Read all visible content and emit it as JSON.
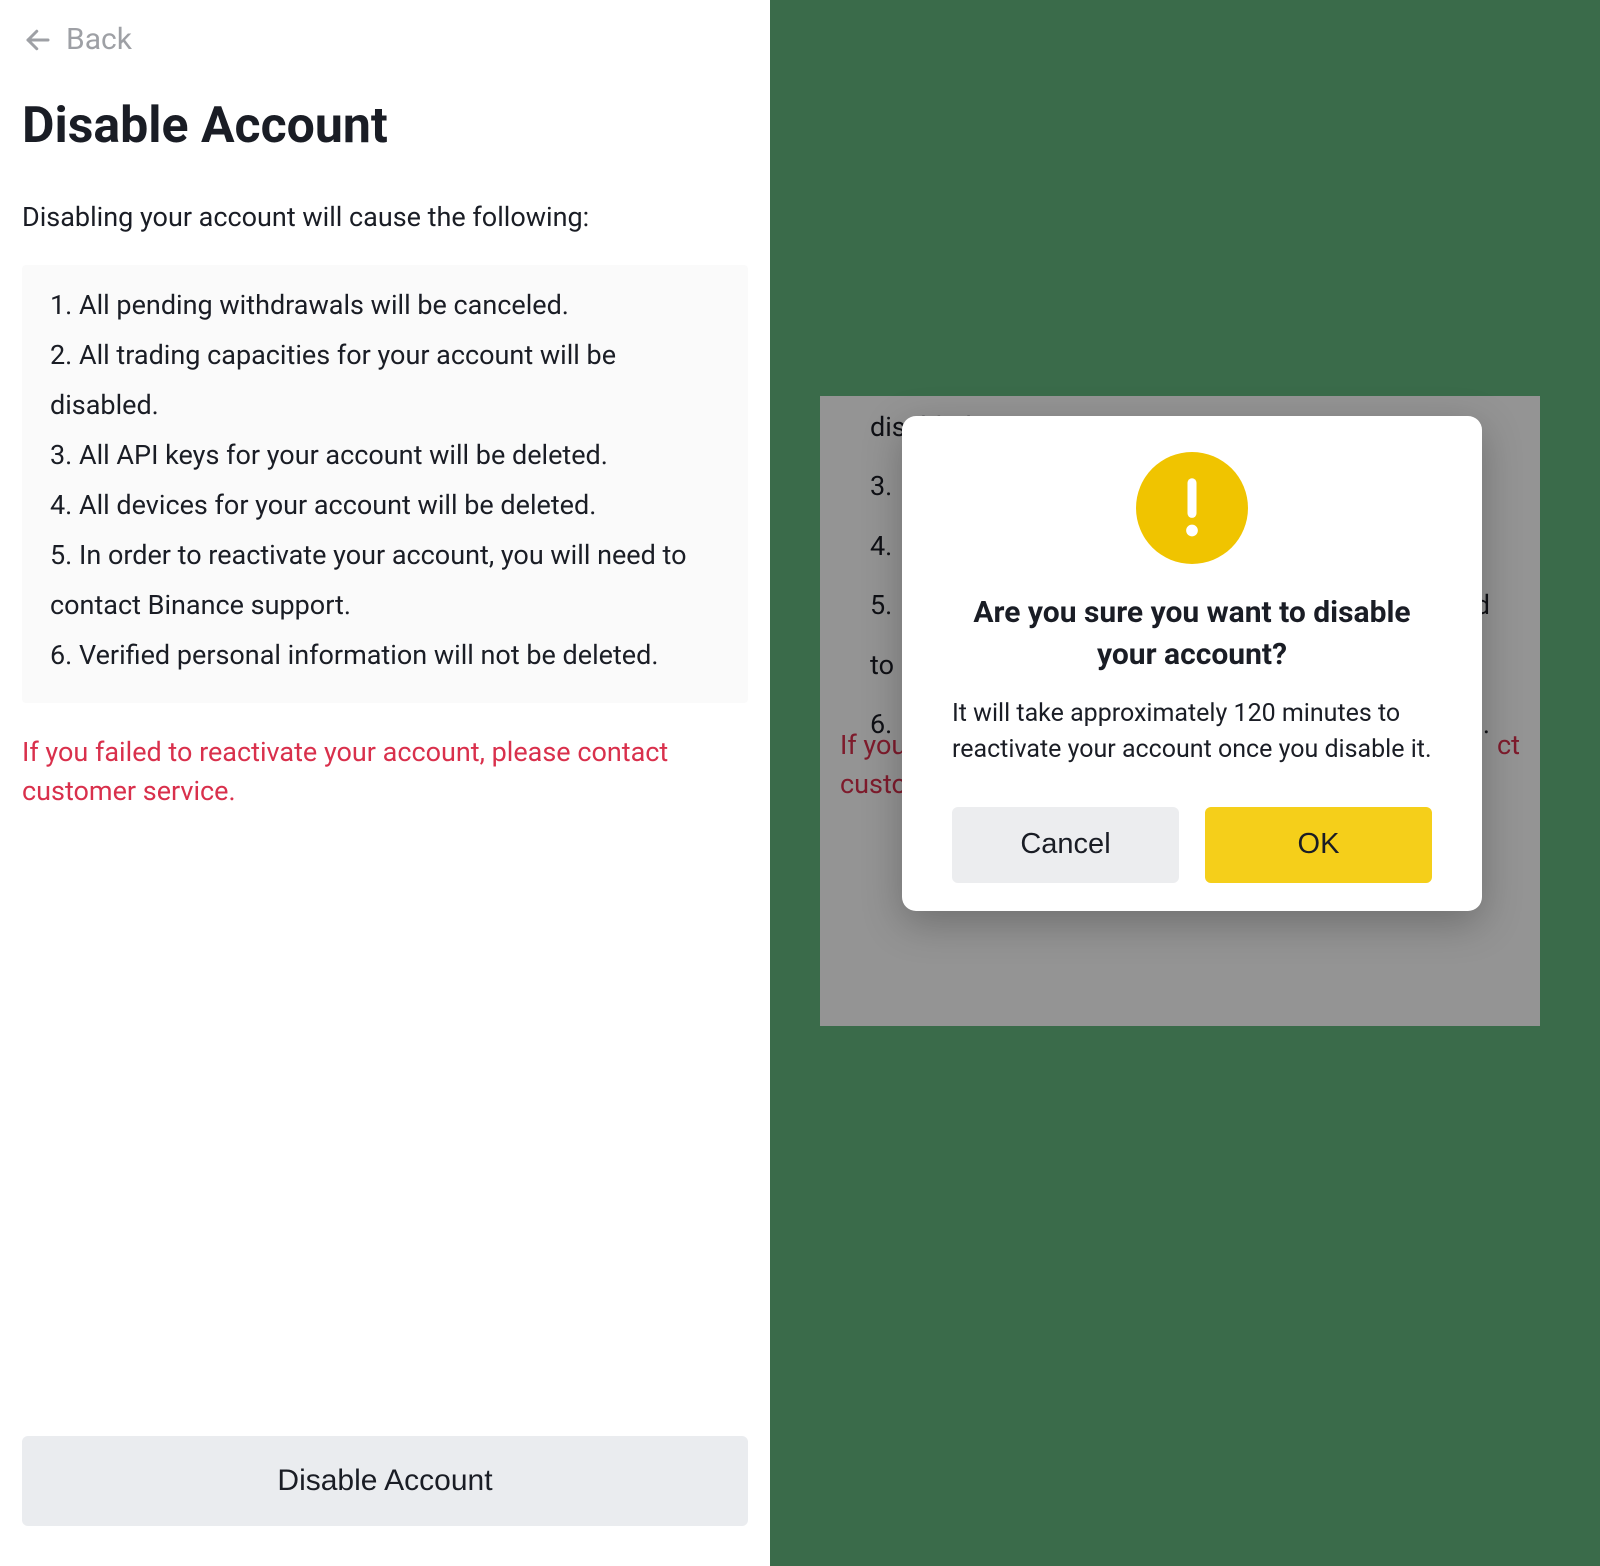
{
  "left": {
    "back_label": "Back",
    "title": "Disable Account",
    "subhead": "Disabling your account will cause the following:",
    "consequences": [
      "1. All pending withdrawals will be canceled.",
      "2. All trading capacities for your account will be disabled.",
      "3. All API keys for your account will be deleted.",
      "4. All devices for your account will be deleted.",
      "5. In order to reactivate your account, you will need to contact Binance support.",
      "6. Verified personal information will not be deleted."
    ],
    "warning": "If you failed to reactivate your account, please contact customer service.",
    "disable_button": "Disable Account"
  },
  "right": {
    "bg_lines": [
      "disabled.",
      "3.",
      "4.",
      "5.",
      "to",
      "6."
    ],
    "bg_line_right_4": "d",
    "bg_line_right_6": "l.",
    "bg_warning_left": "If you",
    "bg_warning_left2": "custo",
    "bg_warning_right": "ct",
    "modal": {
      "title": "Are you sure you want to disable your account?",
      "body": "It will take approximately 120 minutes to reactivate your account once you disable it.",
      "cancel": "Cancel",
      "ok": "OK"
    }
  },
  "colors": {
    "accent_yellow": "#f0c400",
    "danger_red": "#d9304c",
    "right_bg": "#3a6b4a"
  }
}
